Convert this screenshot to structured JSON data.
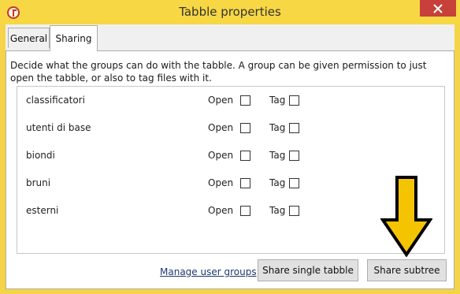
{
  "window": {
    "title": "Tabble properties",
    "close_glyph": "✕"
  },
  "tabs": [
    {
      "label": "General"
    },
    {
      "label": "Sharing"
    }
  ],
  "sharing": {
    "description": "Decide what the groups can do with the tabble. A group can be given permission to just open the tabble, or also to tag files with it.",
    "open_label": "Open",
    "tag_label": "Tag",
    "groups": [
      {
        "name": "classificatori",
        "open": false,
        "tag": false
      },
      {
        "name": "utenti di base",
        "open": false,
        "tag": false
      },
      {
        "name": "biondi",
        "open": false,
        "tag": false
      },
      {
        "name": "bruni",
        "open": false,
        "tag": false
      },
      {
        "name": "esterni",
        "open": false,
        "tag": false
      }
    ],
    "manage_link": "Manage user groups",
    "share_single_label": "Share single tabble",
    "share_subtree_label": "Share subtree"
  },
  "colors": {
    "titlebar": "#f7d744",
    "close_button": "#c7403a",
    "arrow_fill": "#f5c400",
    "link": "#1c3a6e"
  },
  "icons": [
    "tabble-app-icon",
    "close-icon",
    "down-arrow-annotation-icon"
  ]
}
